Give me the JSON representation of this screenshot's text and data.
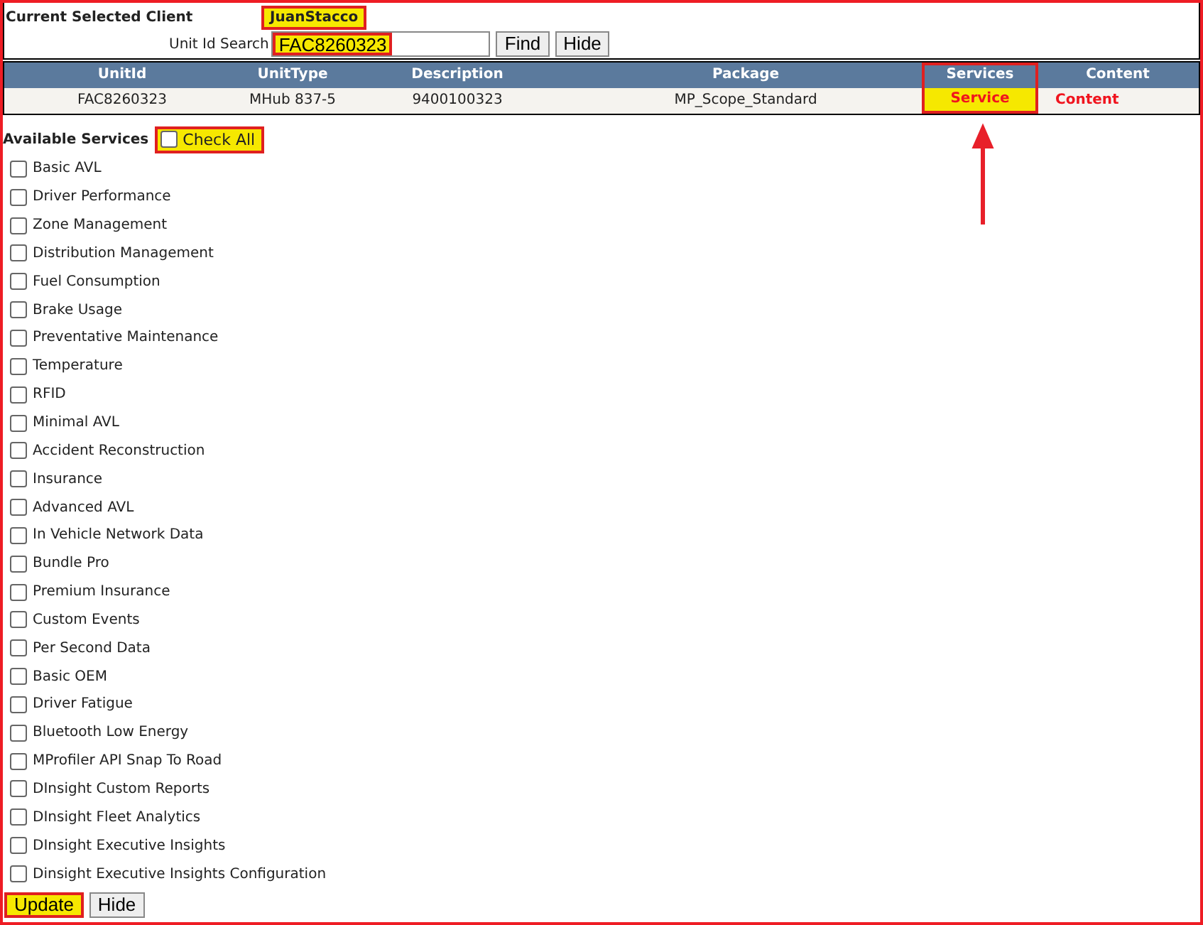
{
  "client": {
    "label": "Current Selected Client",
    "name": "JuanStacco",
    "highlighted": true
  },
  "search": {
    "label": "Unit Id Search",
    "value": "FAC8260323",
    "highlighted": true,
    "buttons": [
      "Find",
      "Hide"
    ]
  },
  "table": {
    "columns": [
      {
        "label": "UnitId",
        "highlighted": false
      },
      {
        "label": "UnitType",
        "highlighted": false
      },
      {
        "label": "Description",
        "highlighted": false
      },
      {
        "label": "Package",
        "highlighted": false
      },
      {
        "label": "Services",
        "highlighted": true
      },
      {
        "label": "Content",
        "highlighted": false
      }
    ],
    "rows": [
      {
        "cells": [
          {
            "text": "FAC8260323",
            "kind": "text"
          },
          {
            "text": "MHub 837-5",
            "kind": "text"
          },
          {
            "text": "9400100323",
            "kind": "text"
          },
          {
            "text": "MP_Scope_Standard",
            "kind": "text"
          },
          {
            "text": "Service",
            "kind": "link"
          },
          {
            "text": "Content",
            "kind": "link"
          }
        ]
      }
    ]
  },
  "services": {
    "label": "Available Services",
    "check_all": {
      "label": "Check All",
      "checked": false,
      "highlighted": true
    },
    "items": [
      {
        "label": "Basic AVL",
        "checked": false
      },
      {
        "label": "Driver Performance",
        "checked": false
      },
      {
        "label": "Zone Management",
        "checked": false
      },
      {
        "label": "Distribution Management",
        "checked": false
      },
      {
        "label": "Fuel Consumption",
        "checked": false
      },
      {
        "label": "Brake Usage",
        "checked": false
      },
      {
        "label": "Preventative Maintenance",
        "checked": false
      },
      {
        "label": "Temperature",
        "checked": false
      },
      {
        "label": "RFID",
        "checked": false
      },
      {
        "label": "Minimal AVL",
        "checked": false
      },
      {
        "label": "Accident Reconstruction",
        "checked": false
      },
      {
        "label": "Insurance",
        "checked": false
      },
      {
        "label": "Advanced AVL",
        "checked": false
      },
      {
        "label": "In Vehicle Network Data",
        "checked": false
      },
      {
        "label": "Bundle Pro",
        "checked": false
      },
      {
        "label": "Premium Insurance",
        "checked": false
      },
      {
        "label": "Custom Events",
        "checked": false
      },
      {
        "label": "Per Second Data",
        "checked": false
      },
      {
        "label": "Basic OEM",
        "checked": false
      },
      {
        "label": "Driver Fatigue",
        "checked": false
      },
      {
        "label": "Bluetooth Low Energy",
        "checked": false
      },
      {
        "label": "MProfiler API Snap To Road",
        "checked": false
      },
      {
        "label": "DInsight Custom Reports",
        "checked": false
      },
      {
        "label": "DInsight Fleet Analytics",
        "checked": false
      },
      {
        "label": "DInsight Executive Insights",
        "checked": false
      },
      {
        "label": "Dinsight Executive Insights Configuration",
        "checked": false
      }
    ]
  },
  "footer_buttons": [
    {
      "label": "Update",
      "highlighted": true
    },
    {
      "label": "Hide",
      "highlighted": false
    }
  ]
}
